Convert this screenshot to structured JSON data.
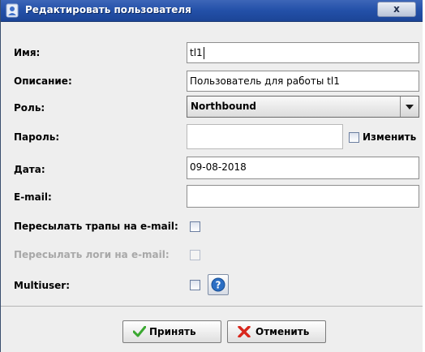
{
  "window": {
    "title": "Редактировать пользователя",
    "close_label": "x"
  },
  "form": {
    "name": {
      "label": "Имя:",
      "value": "tl1"
    },
    "description": {
      "label": "Описание:",
      "value": "Пользователь для работы tl1"
    },
    "role": {
      "label": "Роль:",
      "value": "Northbound"
    },
    "password": {
      "label": "Пароль:",
      "value": "",
      "change_label": "Изменить"
    },
    "date": {
      "label": "Дата:",
      "value": "09-08-2018"
    },
    "email": {
      "label": "E-mail:",
      "value": ""
    },
    "forward_traps": {
      "label": "Пересылать трапы на e-mail:",
      "checked": false
    },
    "forward_logs": {
      "label": "Пересылать логи на e-mail:",
      "checked": false,
      "enabled": false
    },
    "multiuser": {
      "label": "Multiuser:",
      "checked": false
    }
  },
  "buttons": {
    "accept_label": "Принять",
    "cancel_label": "Отменить"
  },
  "icons": {
    "app": "user-icon",
    "accept": "checkmark-icon",
    "cancel": "red-x-icon",
    "help": "question-mark-icon",
    "dropdown": "chevron-down-icon"
  },
  "colors": {
    "title_bar": "#2350a8",
    "accept": "#3aa830",
    "cancel": "#d8261c",
    "help": "#2a6ec4"
  }
}
